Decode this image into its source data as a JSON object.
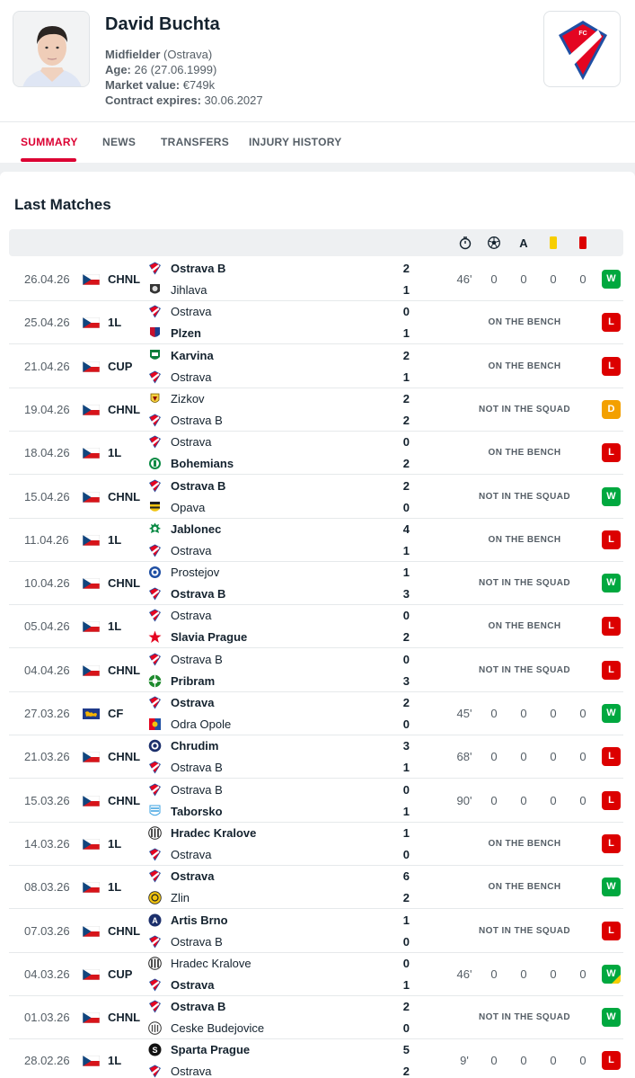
{
  "player": {
    "name": "David Buchta",
    "position_label": "Midfielder",
    "position_team": "(Ostrava)",
    "age_label": "Age:",
    "age_value": "26 (27.06.1999)",
    "market_label": "Market value:",
    "market_value": "€749k",
    "contract_label": "Contract expires:",
    "contract_value": "30.06.2027"
  },
  "tabs": [
    "SUMMARY",
    "NEWS",
    "TRANSFERS",
    "INJURY HISTORY"
  ],
  "section_title": "Last Matches",
  "header_icons": [
    "stopwatch-icon",
    "ball-icon",
    "assist-icon",
    "yellow-card-icon",
    "red-card-icon"
  ],
  "header_assist_letter": "A",
  "matches": [
    {
      "date": "26.04.26",
      "country": "cz",
      "comp": "CHNL",
      "home": "Ostrava B",
      "away": "Jihlava",
      "hs": "2",
      "as": "1",
      "winner": "home",
      "hlogo": "ostrava",
      "alogo": "jihlava",
      "minutes": "46'",
      "goals": "0",
      "assists": "0",
      "yellow": "0",
      "red": "0",
      "status": "",
      "result": "W"
    },
    {
      "date": "25.04.26",
      "country": "cz",
      "comp": "1L",
      "home": "Ostrava",
      "away": "Plzen",
      "hs": "0",
      "as": "1",
      "winner": "away",
      "hlogo": "ostrava",
      "alogo": "plzen",
      "status": "ON THE BENCH",
      "result": "L"
    },
    {
      "date": "21.04.26",
      "country": "cz",
      "comp": "CUP",
      "home": "Karvina",
      "away": "Ostrava",
      "hs": "2",
      "as": "1",
      "winner": "home",
      "hlogo": "karvina",
      "alogo": "ostrava",
      "status": "ON THE BENCH",
      "result": "L"
    },
    {
      "date": "19.04.26",
      "country": "cz",
      "comp": "CHNL",
      "home": "Zizkov",
      "away": "Ostrava B",
      "hs": "2",
      "as": "2",
      "winner": "none",
      "hlogo": "zizkov",
      "alogo": "ostrava",
      "status": "NOT IN THE SQUAD",
      "result": "D"
    },
    {
      "date": "18.04.26",
      "country": "cz",
      "comp": "1L",
      "home": "Ostrava",
      "away": "Bohemians",
      "hs": "0",
      "as": "2",
      "winner": "away",
      "hlogo": "ostrava",
      "alogo": "bohemians",
      "status": "ON THE BENCH",
      "result": "L"
    },
    {
      "date": "15.04.26",
      "country": "cz",
      "comp": "CHNL",
      "home": "Ostrava B",
      "away": "Opava",
      "hs": "2",
      "as": "0",
      "winner": "home",
      "hlogo": "ostrava",
      "alogo": "opava",
      "status": "NOT IN THE SQUAD",
      "result": "W"
    },
    {
      "date": "11.04.26",
      "country": "cz",
      "comp": "1L",
      "home": "Jablonec",
      "away": "Ostrava",
      "hs": "4",
      "as": "1",
      "winner": "home",
      "hlogo": "jablonec",
      "alogo": "ostrava",
      "status": "ON THE BENCH",
      "result": "L"
    },
    {
      "date": "10.04.26",
      "country": "cz",
      "comp": "CHNL",
      "home": "Prostejov",
      "away": "Ostrava B",
      "hs": "1",
      "as": "3",
      "winner": "away",
      "hlogo": "prostejov",
      "alogo": "ostrava",
      "status": "NOT IN THE SQUAD",
      "result": "W"
    },
    {
      "date": "05.04.26",
      "country": "cz",
      "comp": "1L",
      "home": "Ostrava",
      "away": "Slavia Prague",
      "hs": "0",
      "as": "2",
      "winner": "away",
      "hlogo": "ostrava",
      "alogo": "slavia",
      "status": "ON THE BENCH",
      "result": "L"
    },
    {
      "date": "04.04.26",
      "country": "cz",
      "comp": "CHNL",
      "home": "Ostrava B",
      "away": "Pribram",
      "hs": "0",
      "as": "3",
      "winner": "away",
      "hlogo": "ostrava",
      "alogo": "pribram",
      "status": "NOT IN THE SQUAD",
      "result": "L"
    },
    {
      "date": "27.03.26",
      "country": "world",
      "comp": "CF",
      "home": "Ostrava",
      "away": "Odra Opole",
      "hs": "2",
      "as": "0",
      "winner": "home",
      "hlogo": "ostrava",
      "alogo": "odra",
      "minutes": "45'",
      "goals": "0",
      "assists": "0",
      "yellow": "0",
      "red": "0",
      "status": "",
      "result": "W"
    },
    {
      "date": "21.03.26",
      "country": "cz",
      "comp": "CHNL",
      "home": "Chrudim",
      "away": "Ostrava B",
      "hs": "3",
      "as": "1",
      "winner": "home",
      "hlogo": "chrudim",
      "alogo": "ostrava",
      "minutes": "68'",
      "goals": "0",
      "assists": "0",
      "yellow": "0",
      "red": "0",
      "status": "",
      "result": "L"
    },
    {
      "date": "15.03.26",
      "country": "cz",
      "comp": "CHNL",
      "home": "Ostrava B",
      "away": "Taborsko",
      "hs": "0",
      "as": "1",
      "winner": "away",
      "hlogo": "ostrava",
      "alogo": "taborsko",
      "minutes": "90'",
      "goals": "0",
      "assists": "0",
      "yellow": "0",
      "red": "0",
      "status": "",
      "result": "L"
    },
    {
      "date": "14.03.26",
      "country": "cz",
      "comp": "1L",
      "home": "Hradec Kralove",
      "away": "Ostrava",
      "hs": "1",
      "as": "0",
      "winner": "home",
      "hlogo": "hradec",
      "alogo": "ostrava",
      "status": "ON THE BENCH",
      "result": "L"
    },
    {
      "date": "08.03.26",
      "country": "cz",
      "comp": "1L",
      "home": "Ostrava",
      "away": "Zlin",
      "hs": "6",
      "as": "2",
      "winner": "home",
      "hlogo": "ostrava",
      "alogo": "zlin",
      "status": "ON THE BENCH",
      "result": "W"
    },
    {
      "date": "07.03.26",
      "country": "cz",
      "comp": "CHNL",
      "home": "Artis Brno",
      "away": "Ostrava B",
      "hs": "1",
      "as": "0",
      "winner": "home",
      "hlogo": "artis",
      "alogo": "ostrava",
      "status": "NOT IN THE SQUAD",
      "result": "L"
    },
    {
      "date": "04.03.26",
      "country": "cz",
      "comp": "CUP",
      "home": "Hradec Kralove",
      "away": "Ostrava",
      "hs": "0",
      "as": "1",
      "winner": "away",
      "hlogo": "hradec",
      "alogo": "ostrava",
      "minutes": "46'",
      "goals": "0",
      "assists": "0",
      "yellow": "0",
      "red": "0",
      "status": "",
      "result": "W",
      "result_corner": "yellow"
    },
    {
      "date": "01.03.26",
      "country": "cz",
      "comp": "CHNL",
      "home": "Ostrava B",
      "away": "Ceske Budejovice",
      "hs": "2",
      "as": "0",
      "winner": "home",
      "hlogo": "ostrava",
      "alogo": "budejovice",
      "status": "NOT IN THE SQUAD",
      "result": "W"
    },
    {
      "date": "28.02.26",
      "country": "cz",
      "comp": "1L",
      "home": "Sparta Prague",
      "away": "Ostrava",
      "hs": "5",
      "as": "2",
      "winner": "home",
      "hlogo": "sparta",
      "alogo": "ostrava",
      "minutes": "9'",
      "goals": "0",
      "assists": "0",
      "yellow": "0",
      "red": "0",
      "status": "",
      "result": "L"
    }
  ],
  "colors": {
    "accent": "#dc0032",
    "win": "#00a83f",
    "loss": "#dc0000",
    "draw": "#f3a000",
    "ostrava_blue": "#1f4fa3"
  }
}
